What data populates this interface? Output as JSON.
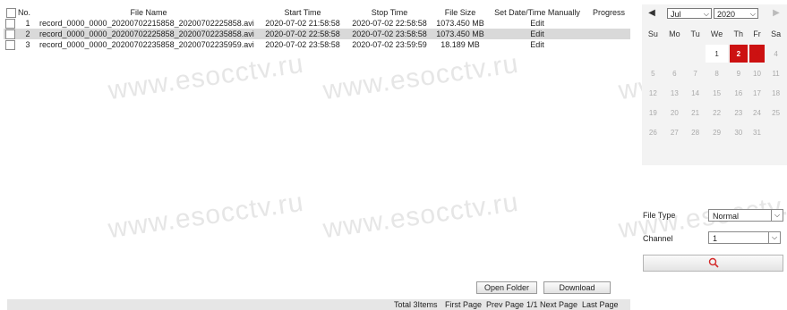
{
  "watermark": "www.esocctv.ru",
  "columns": [
    "No.",
    "File Name",
    "Start Time",
    "Stop Time",
    "File Size",
    "Set Date/Time Manually",
    "Progress"
  ],
  "files": [
    {
      "no": "1",
      "name": "record_0000_0000_20200702215858_20200702225858.avi",
      "start": "2020-07-02 21:58:58",
      "stop": "2020-07-02 22:58:58",
      "size": "1073.450 MB",
      "action": "Edit",
      "selected": false
    },
    {
      "no": "2",
      "name": "record_0000_0000_20200702225858_20200702235858.avi",
      "start": "2020-07-02 22:58:58",
      "stop": "2020-07-02 23:58:58",
      "size": "1073.450 MB",
      "action": "Edit",
      "selected": true
    },
    {
      "no": "3",
      "name": "record_0000_0000_20200702235858_20200702235959.avi",
      "start": "2020-07-02 23:58:58",
      "stop": "2020-07-02 23:59:59",
      "size": "18.189 MB",
      "action": "Edit",
      "selected": false
    }
  ],
  "buttons": {
    "open_folder": "Open Folder",
    "download": "Download"
  },
  "pager": {
    "total": "Total 3Items",
    "first": "First Page",
    "prev": "Prev Page",
    "info": "1/1",
    "next": "Next Page",
    "last": "Last Page"
  },
  "calendar": {
    "month": "Jul",
    "year": "2020",
    "weekdays": [
      "Su",
      "Mo",
      "Tu",
      "We",
      "Th",
      "Fr",
      "Sa"
    ],
    "weeks": [
      [
        "",
        "",
        "",
        "1",
        "2",
        "3",
        "4"
      ],
      [
        "5",
        "6",
        "7",
        "8",
        "9",
        "10",
        "11"
      ],
      [
        "12",
        "13",
        "14",
        "15",
        "16",
        "17",
        "18"
      ],
      [
        "19",
        "20",
        "21",
        "22",
        "23",
        "24",
        "25"
      ],
      [
        "26",
        "27",
        "28",
        "29",
        "30",
        "31",
        ""
      ]
    ],
    "highlight_today": "2",
    "highlight_record": "3",
    "active_days": [
      "1",
      "2",
      "3"
    ],
    "accent_color": "#cc1111"
  },
  "filters": {
    "file_type_label": "File Type",
    "file_type_value": "Normal",
    "channel_label": "Channel",
    "channel_value": "1"
  },
  "icons": {
    "search": "search-icon",
    "prev": "prev-month-icon",
    "next": "next-month-icon"
  }
}
